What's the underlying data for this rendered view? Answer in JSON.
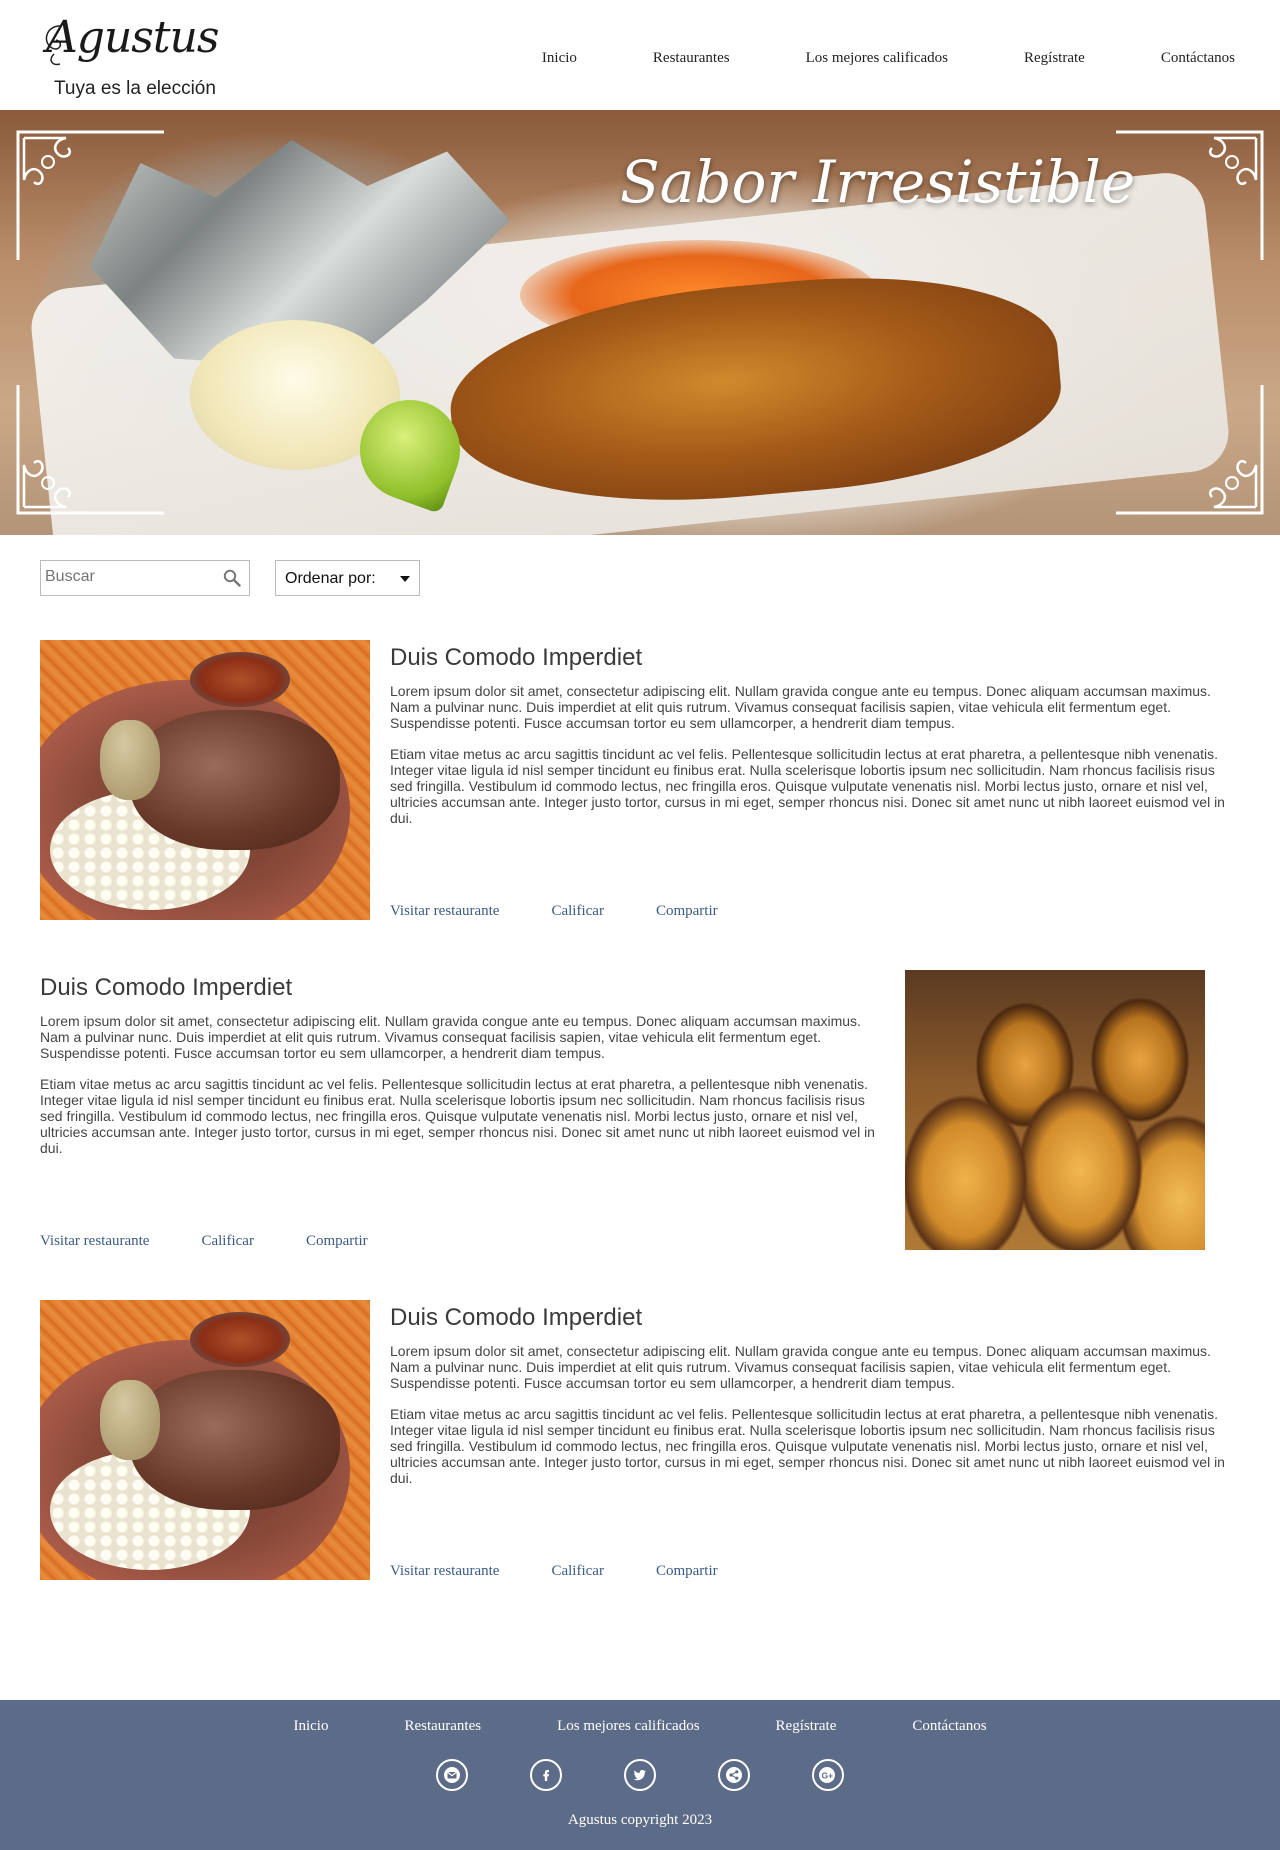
{
  "brand": {
    "name": "Agustus",
    "tagline": "Tuya es la elección"
  },
  "nav": [
    {
      "label": "Inicio"
    },
    {
      "label": "Restaurantes"
    },
    {
      "label": "Los mejores calificados"
    },
    {
      "label": "Regístrate"
    },
    {
      "label": "Contáctanos"
    }
  ],
  "hero": {
    "title": "Sabor Irresistible"
  },
  "search": {
    "placeholder": "Buscar",
    "icon": "search-icon"
  },
  "sort": {
    "label": "Ordenar por:"
  },
  "cards": [
    {
      "title": "Duis Comodo Imperdiet",
      "p1": "Lorem ipsum dolor sit amet, consectetur adipiscing elit. Nullam gravida congue ante eu tempus. Donec aliquam accumsan maximus. Nam a pulvinar nunc. Duis imperdiet at elit quis rutrum. Vivamus consequat facilisis sapien, vitae vehicula elit fermentum eget. Suspendisse potenti. Fusce accumsan tortor eu sem ullamcorper, a hendrerit diam tempus.",
      "p2": "Etiam vitae metus ac arcu sagittis tincidunt ac vel felis. Pellentesque sollicitudin lectus at erat pharetra, a pellentesque nibh venenatis. Integer vitae ligula id nisl semper tincidunt eu finibus erat. Nulla scelerisque lobortis ipsum nec sollicitudin. Nam rhoncus facilisis risus sed fringilla. Vestibulum id commodo lectus, nec fringilla eros. Quisque vulputate venenatis nisl. Morbi lectus justo, ornare et nisl vel, ultricies accumsan ante. Integer justo tortor, cursus in mi eget, semper rhoncus nisi. Donec sit amet nunc ut nibh laoreet euismod vel in dui.",
      "visit": "Visitar restaurante",
      "rate": "Calificar",
      "share": "Compartir"
    },
    {
      "title": "Duis Comodo Imperdiet",
      "p1": "Lorem ipsum dolor sit amet, consectetur adipiscing elit. Nullam gravida congue ante eu tempus. Donec aliquam accumsan maximus. Nam a pulvinar nunc. Duis imperdiet at elit quis rutrum. Vivamus consequat facilisis sapien, vitae vehicula elit fermentum eget. Suspendisse potenti. Fusce accumsan tortor eu sem ullamcorper, a hendrerit diam tempus.",
      "p2": "Etiam vitae metus ac arcu sagittis tincidunt ac vel felis. Pellentesque sollicitudin lectus at erat pharetra, a pellentesque nibh venenatis. Integer vitae ligula id nisl semper tincidunt eu finibus erat. Nulla scelerisque lobortis ipsum nec sollicitudin. Nam rhoncus facilisis risus sed fringilla. Vestibulum id commodo lectus, nec fringilla eros. Quisque vulputate venenatis nisl. Morbi lectus justo, ornare et nisl vel, ultricies accumsan ante. Integer justo tortor, cursus in mi eget, semper rhoncus nisi. Donec sit amet nunc ut nibh laoreet euismod vel in dui.",
      "visit": "Visitar restaurante",
      "rate": "Calificar",
      "share": "Compartir"
    },
    {
      "title": "Duis Comodo Imperdiet",
      "p1": "Lorem ipsum dolor sit amet, consectetur adipiscing elit. Nullam gravida congue ante eu tempus. Donec aliquam accumsan maximus. Nam a pulvinar nunc. Duis imperdiet at elit quis rutrum. Vivamus consequat facilisis sapien, vitae vehicula elit fermentum eget. Suspendisse potenti. Fusce accumsan tortor eu sem ullamcorper, a hendrerit diam tempus.",
      "p2": "Etiam vitae metus ac arcu sagittis tincidunt ac vel felis. Pellentesque sollicitudin lectus at erat pharetra, a pellentesque nibh venenatis. Integer vitae ligula id nisl semper tincidunt eu finibus erat. Nulla scelerisque lobortis ipsum nec sollicitudin. Nam rhoncus facilisis risus sed fringilla. Vestibulum id commodo lectus, nec fringilla eros. Quisque vulputate venenatis nisl. Morbi lectus justo, ornare et nisl vel, ultricies accumsan ante. Integer justo tortor, cursus in mi eget, semper rhoncus nisi. Donec sit amet nunc ut nibh laoreet euismod vel in dui.",
      "visit": "Visitar restaurante",
      "rate": "Calificar",
      "share": "Compartir"
    }
  ],
  "footer": {
    "nav": [
      {
        "label": "Inicio"
      },
      {
        "label": "Restaurantes"
      },
      {
        "label": "Los mejores calificados"
      },
      {
        "label": "Regístrate"
      },
      {
        "label": "Contáctanos"
      }
    ],
    "social": [
      "email-icon",
      "facebook-icon",
      "twitter-icon",
      "share-icon",
      "google-plus-icon"
    ],
    "copyright": "Agustus copyright 2023",
    "background": "#5c6b87"
  },
  "colors": {
    "link": "#3b5b85",
    "text": "#444444"
  }
}
